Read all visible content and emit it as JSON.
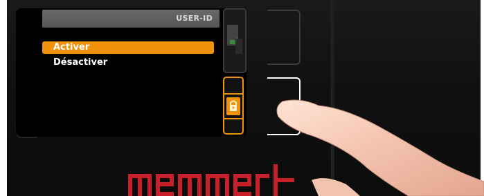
{
  "header": {
    "title": "USER-ID"
  },
  "menu": {
    "items": [
      {
        "label": "Activer",
        "selected": true
      },
      {
        "label": "Désactiver",
        "selected": false
      }
    ]
  },
  "brand": {
    "logo_text": "memmerƚ"
  },
  "icons": {
    "left_top": "ramp-graph-icon",
    "left_middle": "clock-icon",
    "right_top": "export-icon",
    "right_active": "lock-icon"
  },
  "colors": {
    "accent": "#f0920a",
    "logo": "#c8202a",
    "header_bar": "#5e5e5e",
    "panel": "#111111"
  }
}
